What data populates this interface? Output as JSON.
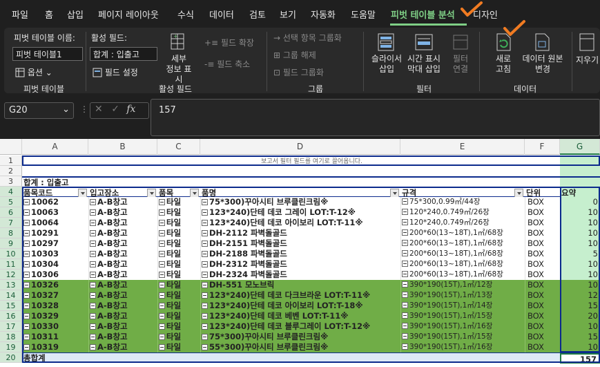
{
  "tabs": [
    "파일",
    "홈",
    "삽입",
    "페이지 레이아웃",
    "수식",
    "데이터",
    "검토",
    "보기",
    "자동화",
    "도움말",
    "피벗 테이블 분석",
    "디자인"
  ],
  "active_tab_index": 10,
  "ribbon": {
    "pivot_name_label": "피벗 테이블 이름:",
    "pivot_name_value": "피벗 테이블1",
    "options_label": "옵션",
    "group_pivot": "피벗 테이블",
    "active_field_label": "활성 필드:",
    "active_field_value": "합계 : 입출고",
    "field_settings": "필드 설정",
    "drill_down": "세부\n정보 표시",
    "field_expand": "필드 확장",
    "field_collapse": "필드 축소",
    "group_active": "활성 필드",
    "group_selection": "선택 항목 그룹화",
    "ungroup": "그룹 해제",
    "group_field": "필드 그룹화",
    "group_group": "그룹",
    "insert_slicer": "슬라이서\n삽입",
    "insert_timeline": "시간 표시\n막대 삽입",
    "filter_connections": "필터\n연결",
    "group_filter": "필터",
    "refresh": "새로\n고침",
    "change_source": "데이터 원본\n변경",
    "group_data": "데이터",
    "clear": "지우기"
  },
  "formula_bar": {
    "name_box": "G20",
    "value": "157"
  },
  "grid": {
    "columns": [
      "A",
      "B",
      "C",
      "D",
      "E",
      "F",
      "G"
    ],
    "selected_column": "G",
    "filter_hint": "보고서 필터 필드를 여기로 끌어옵니다.",
    "sum_title": "합계 : 입출고",
    "headers": [
      "품목코드",
      "입고장소",
      "품목",
      "품명",
      "규격",
      "단위",
      "요약"
    ],
    "rows": [
      {
        "code": "10062",
        "loc": "A-B창고",
        "item": "타일",
        "name": "75*300)꾸아시티 브루클린크림※",
        "spec": "75*300,0.99㎡/44장",
        "unit": "BOX",
        "sum": "0",
        "green": false
      },
      {
        "code": "10063",
        "loc": "A-B창고",
        "item": "타일",
        "name": "123*240)단테 데코 그레이 LOT:T-12※",
        "spec": "120*240,0.749㎡/26장",
        "unit": "BOX",
        "sum": "10",
        "green": false
      },
      {
        "code": "10064",
        "loc": "A-B창고",
        "item": "타일",
        "name": "123*240)단테 데코 아이보리 LOT:T-11※",
        "spec": "120*240,0.749㎡/26장",
        "unit": "BOX",
        "sum": "10",
        "green": false
      },
      {
        "code": "10291",
        "loc": "A-B창고",
        "item": "타일",
        "name": "DH-2112 파벽돌골드",
        "spec": "200*60(13~18T),1㎡/68장",
        "unit": "BOX",
        "sum": "10",
        "green": false
      },
      {
        "code": "10297",
        "loc": "A-B창고",
        "item": "타일",
        "name": "DH-2151 파벽돌골드",
        "spec": "200*60(13~18T),1㎡/68장",
        "unit": "BOX",
        "sum": "10",
        "green": false
      },
      {
        "code": "10303",
        "loc": "A-B창고",
        "item": "타일",
        "name": "DH-2188 파벽돌골드",
        "spec": "200*60(13~18T),1㎡/68장",
        "unit": "BOX",
        "sum": "5",
        "green": false
      },
      {
        "code": "10304",
        "loc": "A-B창고",
        "item": "타일",
        "name": "DH-2312 파벽돌골드",
        "spec": "200*60(13~18T),1㎡/68장",
        "unit": "BOX",
        "sum": "10",
        "green": false
      },
      {
        "code": "10306",
        "loc": "A-B창고",
        "item": "타일",
        "name": "DH-2324 파벽돌골드",
        "spec": "200*60(13~18T),1㎡/68장",
        "unit": "BOX",
        "sum": "10",
        "green": false
      },
      {
        "code": "10326",
        "loc": "A-B창고",
        "item": "타일",
        "name": "DH-551 모노브릭",
        "spec": "390*190(15T),1㎡/12장",
        "unit": "BOX",
        "sum": "10",
        "green": true
      },
      {
        "code": "10327",
        "loc": "A-B창고",
        "item": "타일",
        "name": "123*240)단테 데코 다크브라운 LOT:T-11※",
        "spec": "390*190(15T),1㎡/13장",
        "unit": "BOX",
        "sum": "12",
        "green": true
      },
      {
        "code": "10328",
        "loc": "A-B창고",
        "item": "타일",
        "name": "123*240)단테 데코 아이보리 LOT:T-18※",
        "spec": "390*190(15T),1㎡/14장",
        "unit": "BOX",
        "sum": "15",
        "green": true
      },
      {
        "code": "10329",
        "loc": "A-B창고",
        "item": "타일",
        "name": "123*240)단테 데코 베벤 LOT:T-11※",
        "spec": "390*190(15T),1㎡/15장",
        "unit": "BOX",
        "sum": "20",
        "green": true
      },
      {
        "code": "10330",
        "loc": "A-B창고",
        "item": "타일",
        "name": "123*240)단테 데코 블루그레이 LOT:T-12※",
        "spec": "390*190(15T),1㎡/16장",
        "unit": "BOX",
        "sum": "10",
        "green": true
      },
      {
        "code": "10311",
        "loc": "A-B창고",
        "item": "타일",
        "name": "75*300)꾸아시티 브루클린크림※",
        "spec": "390*190(15T),1㎡/15장",
        "unit": "BOX",
        "sum": "15",
        "green": true
      },
      {
        "code": "10319",
        "loc": "A-B창고",
        "item": "타일",
        "name": "55*300)꾸아시티 브루클린크림※",
        "spec": "390*190(15T),1㎡/16장",
        "unit": "BOX",
        "sum": "10",
        "green": true
      }
    ],
    "total_label": "총합계",
    "total_value": "157"
  },
  "colors": {
    "green_row": "#70ad47",
    "summary_col": "#c6efce",
    "accent": "#7fcf86",
    "check_mark": "#f07b22",
    "selection_border": "#0b2a8c"
  }
}
